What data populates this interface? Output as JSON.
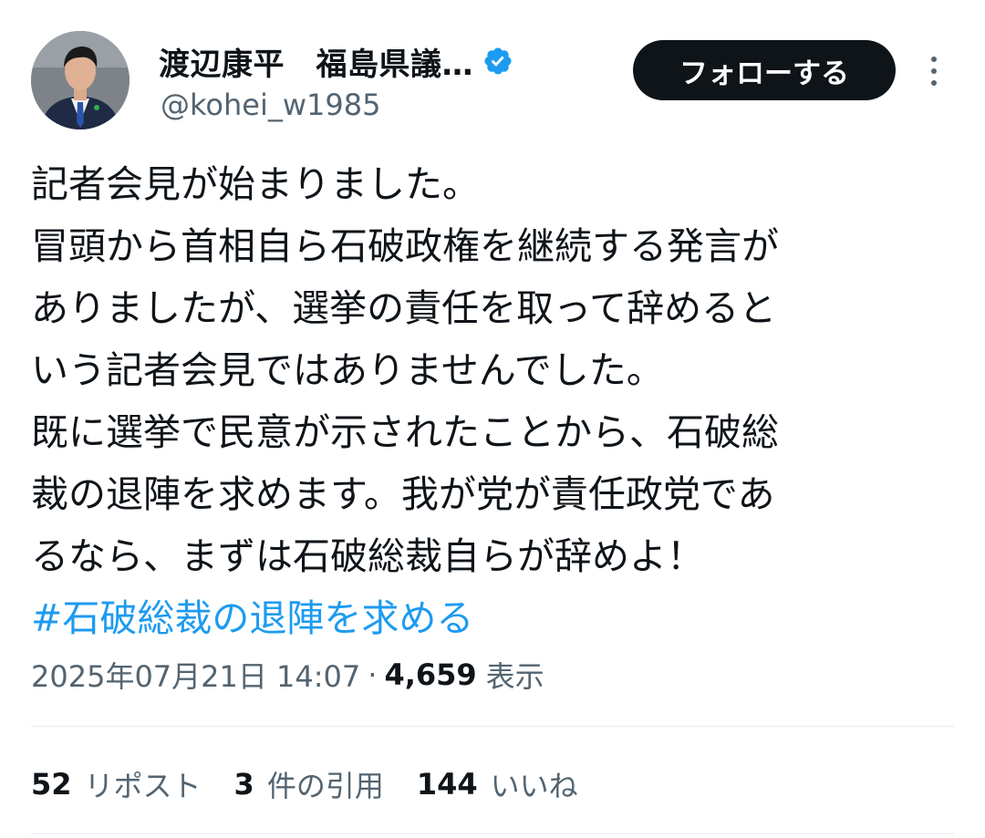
{
  "author": {
    "display_name": "渡辺康平　福島県議…",
    "handle": "@kohei_w1985",
    "verified_color": "#1d9bf0"
  },
  "follow_button_label": "フォローする",
  "tweet": {
    "lines": [
      "記者会見が始まりました。",
      "冒頭から首相自ら石破政権を継続する発言が",
      "ありましたが、選挙の責任を取って辞めると",
      "いう記者会見ではありませんでした。",
      "既に選挙で民意が示されたことから、石破総",
      "裁の退陣を求めます。我が党が責任政党であ",
      "るなら、まずは石破総裁自らが辞めよ！"
    ],
    "hashtag": "#石破総裁の退陣を求める"
  },
  "meta": {
    "timestamp": "2025年07月21日 14:07",
    "separator": "·",
    "views_count": "4,659",
    "views_label": "表示"
  },
  "stats": {
    "reposts_count": "52",
    "reposts_label": "リポスト",
    "quotes_count": "3",
    "quotes_label": "件の引用",
    "likes_count": "144",
    "likes_label": "いいね"
  },
  "colors": {
    "text": "#0f1419",
    "secondary": "#536471",
    "link": "#1d9bf0",
    "button_bg": "#0f1419"
  }
}
